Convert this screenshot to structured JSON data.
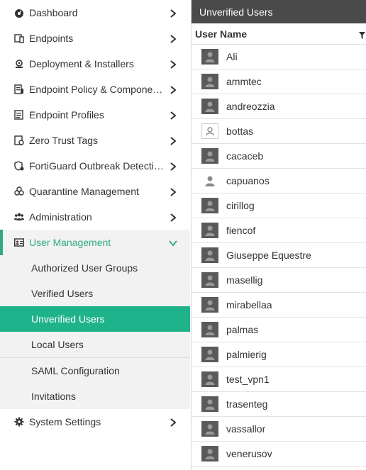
{
  "nav": {
    "items": [
      {
        "label": "Dashboard",
        "icon": "dashboard-icon"
      },
      {
        "label": "Endpoints",
        "icon": "endpoints-icon"
      },
      {
        "label": "Deployment & Installers",
        "icon": "deployment-icon"
      },
      {
        "label": "Endpoint Policy & Components",
        "icon": "policy-icon"
      },
      {
        "label": "Endpoint Profiles",
        "icon": "profiles-icon"
      },
      {
        "label": "Zero Trust Tags",
        "icon": "tags-icon"
      },
      {
        "label": "FortiGuard Outbreak Detecti…",
        "icon": "shield-icon"
      },
      {
        "label": "Quarantine Management",
        "icon": "biohazard-icon"
      },
      {
        "label": "Administration",
        "icon": "users-icon"
      },
      {
        "label": "User Management",
        "icon": "id-card-icon"
      }
    ],
    "user_management_sub": [
      {
        "label": "Authorized User Groups"
      },
      {
        "label": "Verified Users"
      },
      {
        "label": "Unverified Users"
      },
      {
        "label": "Local Users"
      },
      {
        "label": "SAML Configuration"
      },
      {
        "label": "Invitations"
      }
    ],
    "system_settings": {
      "label": "System Settings",
      "icon": "gear-icon"
    }
  },
  "panel": {
    "title": "Unverified Users",
    "column_header": "User Name",
    "rows": [
      {
        "name": "Ali",
        "avatar": "dark"
      },
      {
        "name": "ammtec",
        "avatar": "dark"
      },
      {
        "name": "andreozzia",
        "avatar": "dark"
      },
      {
        "name": "bottas",
        "avatar": "outline"
      },
      {
        "name": "cacaceb",
        "avatar": "dark"
      },
      {
        "name": "capuanos",
        "avatar": "plain"
      },
      {
        "name": "cirillog",
        "avatar": "dark"
      },
      {
        "name": "fiencof",
        "avatar": "dark"
      },
      {
        "name": "Giuseppe Equestre",
        "avatar": "dark"
      },
      {
        "name": "masellig",
        "avatar": "dark"
      },
      {
        "name": "mirabellaa",
        "avatar": "dark"
      },
      {
        "name": "palmas",
        "avatar": "dark"
      },
      {
        "name": "palmierig",
        "avatar": "dark"
      },
      {
        "name": "test_vpn1",
        "avatar": "dark"
      },
      {
        "name": "trasenteg",
        "avatar": "dark"
      },
      {
        "name": "vassallor",
        "avatar": "dark"
      },
      {
        "name": "venerusov",
        "avatar": "dark"
      }
    ]
  },
  "colors": {
    "accent": "#1fb38b",
    "header_bg": "#4a4a4a"
  }
}
